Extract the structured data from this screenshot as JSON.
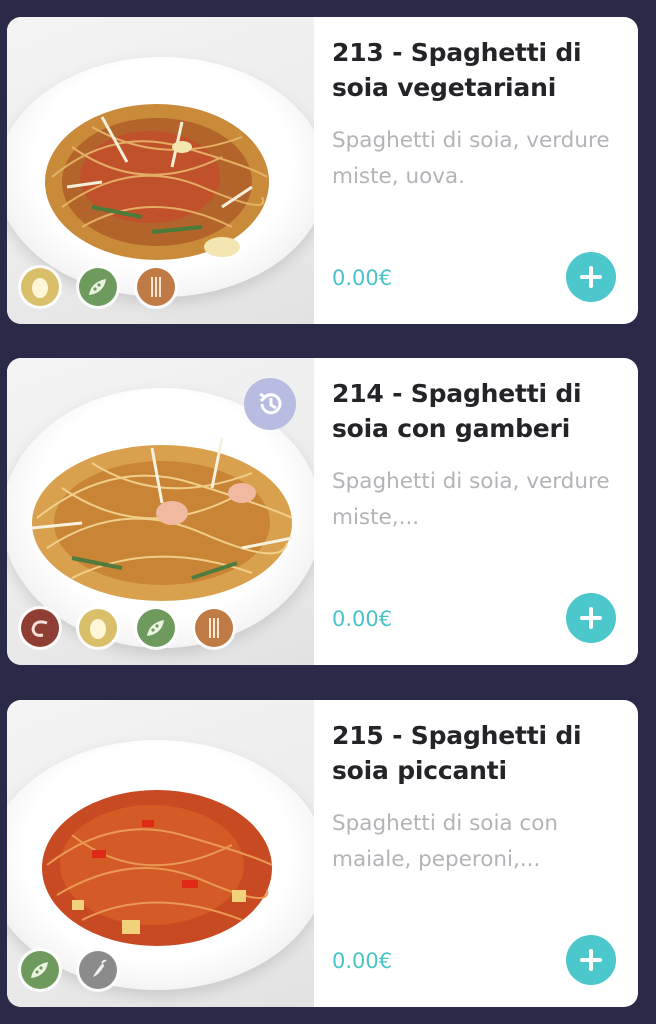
{
  "items": [
    {
      "title": "213 - Spaghetti di soia vegetariani",
      "description": "Spaghetti di soia, verdure miste, uova.",
      "price": "0.00€",
      "allergens": [
        "egg-icon",
        "vegetable-icon",
        "wheat-icon"
      ]
    },
    {
      "title": "214 - Spaghetti di soia con gamberi",
      "description": "Spaghetti di soia, verdure miste,...",
      "price": "0.00€",
      "allergens": [
        "shrimp-icon",
        "egg-icon",
        "vegetable-icon",
        "wheat-icon"
      ],
      "status_icon": "history-icon"
    },
    {
      "title": "215 - Spaghetti di soia piccanti",
      "description": "Spaghetti di soia con maiale, peperoni,...",
      "price": "0.00€",
      "allergens": [
        "vegetable-icon",
        "chili-icon"
      ]
    }
  ],
  "colors": {
    "background": "#2a2a48",
    "card": "#ffffff",
    "accent": "#4cc7cb",
    "price": "#48c4c8",
    "title": "#232328",
    "description": "#b3b3b8",
    "egg_badge": "#d9bf6a",
    "vegetable_badge": "#6f9a5e",
    "wheat_badge": "#c07a45",
    "shrimp_badge": "#8e3e33",
    "chili_badge": "#8b8b8b",
    "history_badge": "#b8bce0"
  }
}
